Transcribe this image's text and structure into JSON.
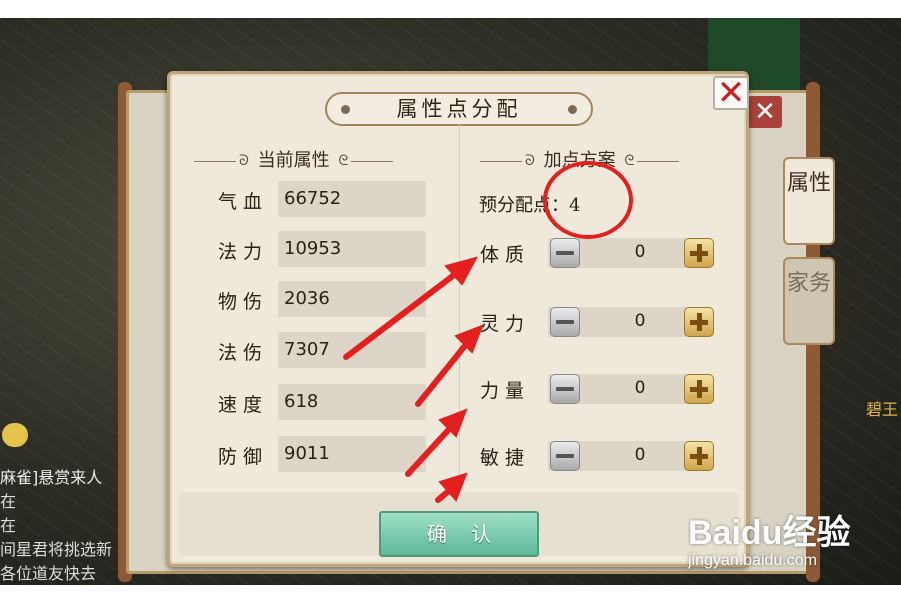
{
  "dialog": {
    "title": "属性点分配",
    "close_symbol": "✕"
  },
  "current": {
    "heading": "当前属性",
    "stats": [
      {
        "label": "气血",
        "value": "66752"
      },
      {
        "label": "法力",
        "value": "10953"
      },
      {
        "label": "物伤",
        "value": "2036"
      },
      {
        "label": "法伤",
        "value": "7307"
      },
      {
        "label": "速度",
        "value": "618"
      },
      {
        "label": "防御",
        "value": "9011"
      }
    ]
  },
  "plan": {
    "heading": "加点方案",
    "pre_alloc_label": "预分配点：4",
    "rows": [
      {
        "label": "体质",
        "value": "0"
      },
      {
        "label": "灵力",
        "value": "0"
      },
      {
        "label": "力量",
        "value": "0"
      },
      {
        "label": "敏捷",
        "value": "0"
      }
    ]
  },
  "confirm_label": "确认",
  "side_tabs": [
    {
      "label": "属性"
    },
    {
      "label": "家务"
    }
  ],
  "background": {
    "close_symbol": "✕",
    "chat_lines": [
      "麻雀]悬赏来人",
      "在",
      "在",
      "间星君将挑选新",
      "各位道友快去"
    ],
    "right_name": "碧王"
  },
  "watermark": {
    "brand": "Baidu经验",
    "url": "jingyan.baidu.com"
  },
  "annotation_colors": {
    "arrow": "#e51e1e",
    "circle": "#e51e1e"
  }
}
